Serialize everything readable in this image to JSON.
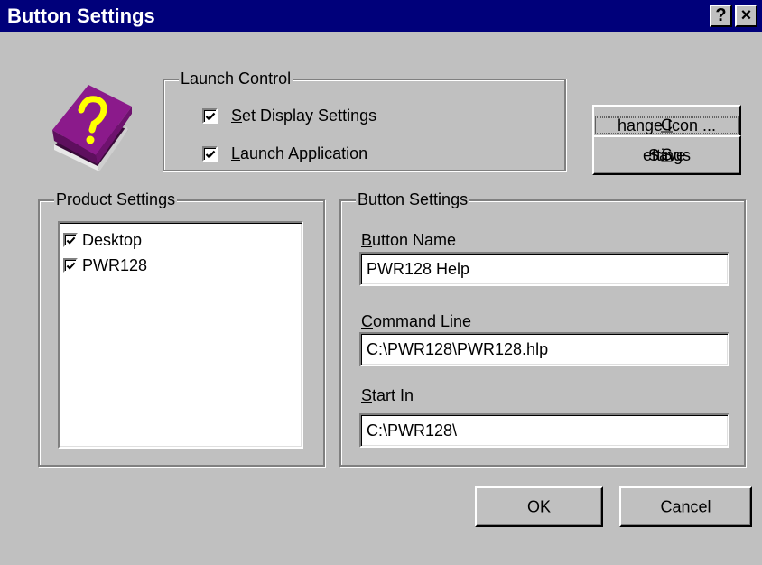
{
  "window": {
    "title": "Button Settings",
    "help_button": "?",
    "close_button": "×"
  },
  "app_icon": "help-book-icon",
  "launch_control": {
    "title": "Launch Control",
    "options": [
      {
        "pre": "",
        "mnemonic": "S",
        "post": "et Display Settings",
        "checked": true
      },
      {
        "pre": "",
        "mnemonic": "L",
        "post": "aunch Application",
        "checked": true
      }
    ]
  },
  "actions": {
    "change_icon": {
      "pre": "",
      "mnemonic": "C",
      "post": "hange Icon ..."
    },
    "save_settings": {
      "pre": "Save ",
      "mnemonic": "S",
      "post": "ettings"
    }
  },
  "product_settings": {
    "title": "Product Settings",
    "items": [
      {
        "label": "Desktop",
        "checked": true
      },
      {
        "label": "PWR128",
        "checked": true
      }
    ]
  },
  "button_settings": {
    "title": "Button Settings",
    "fields": [
      {
        "label_pre": "",
        "label_mnemonic": "B",
        "label_post": "utton Name",
        "value": "PWR128 Help"
      },
      {
        "label_pre": "",
        "label_mnemonic": "C",
        "label_post": "ommand Line",
        "value": "C:\\PWR128\\PWR128.hlp"
      },
      {
        "label_pre": "",
        "label_mnemonic": "S",
        "label_post": "tart In",
        "value": "C:\\PWR128\\"
      }
    ]
  },
  "footer": {
    "ok": "OK",
    "cancel": "Cancel"
  },
  "colors": {
    "titlebar": "#00007a",
    "face": "#c0c0c0",
    "book_cover": "#8b1a8b",
    "question_mark": "#ffff00"
  }
}
